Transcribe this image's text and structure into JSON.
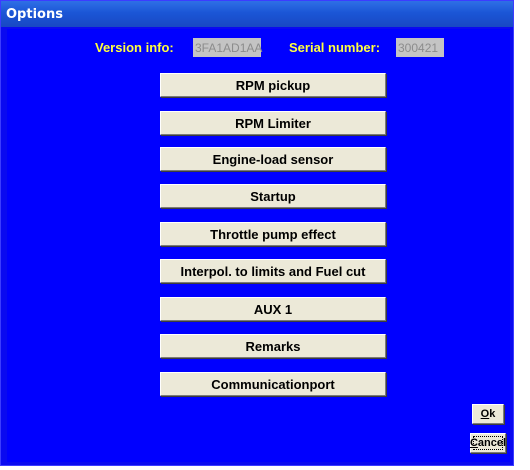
{
  "window": {
    "title": "Options"
  },
  "info": {
    "version_label": "Version info:",
    "version_value": "3FA1AD1AA",
    "serial_label": "Serial number:",
    "serial_value": "300421"
  },
  "options": [
    "RPM pickup",
    "RPM Limiter",
    "Engine-load sensor",
    "Startup",
    "Throttle pump effect",
    "Interpol. to limits and Fuel cut",
    "AUX 1",
    "Remarks",
    "Communicationport"
  ],
  "dialog_buttons": {
    "ok_label": "Ok",
    "ok_mnemonic": "O",
    "ok_rest": "k",
    "cancel_label": "Cancel",
    "cancel_mnemonic": "C",
    "cancel_rest": "ancel"
  }
}
